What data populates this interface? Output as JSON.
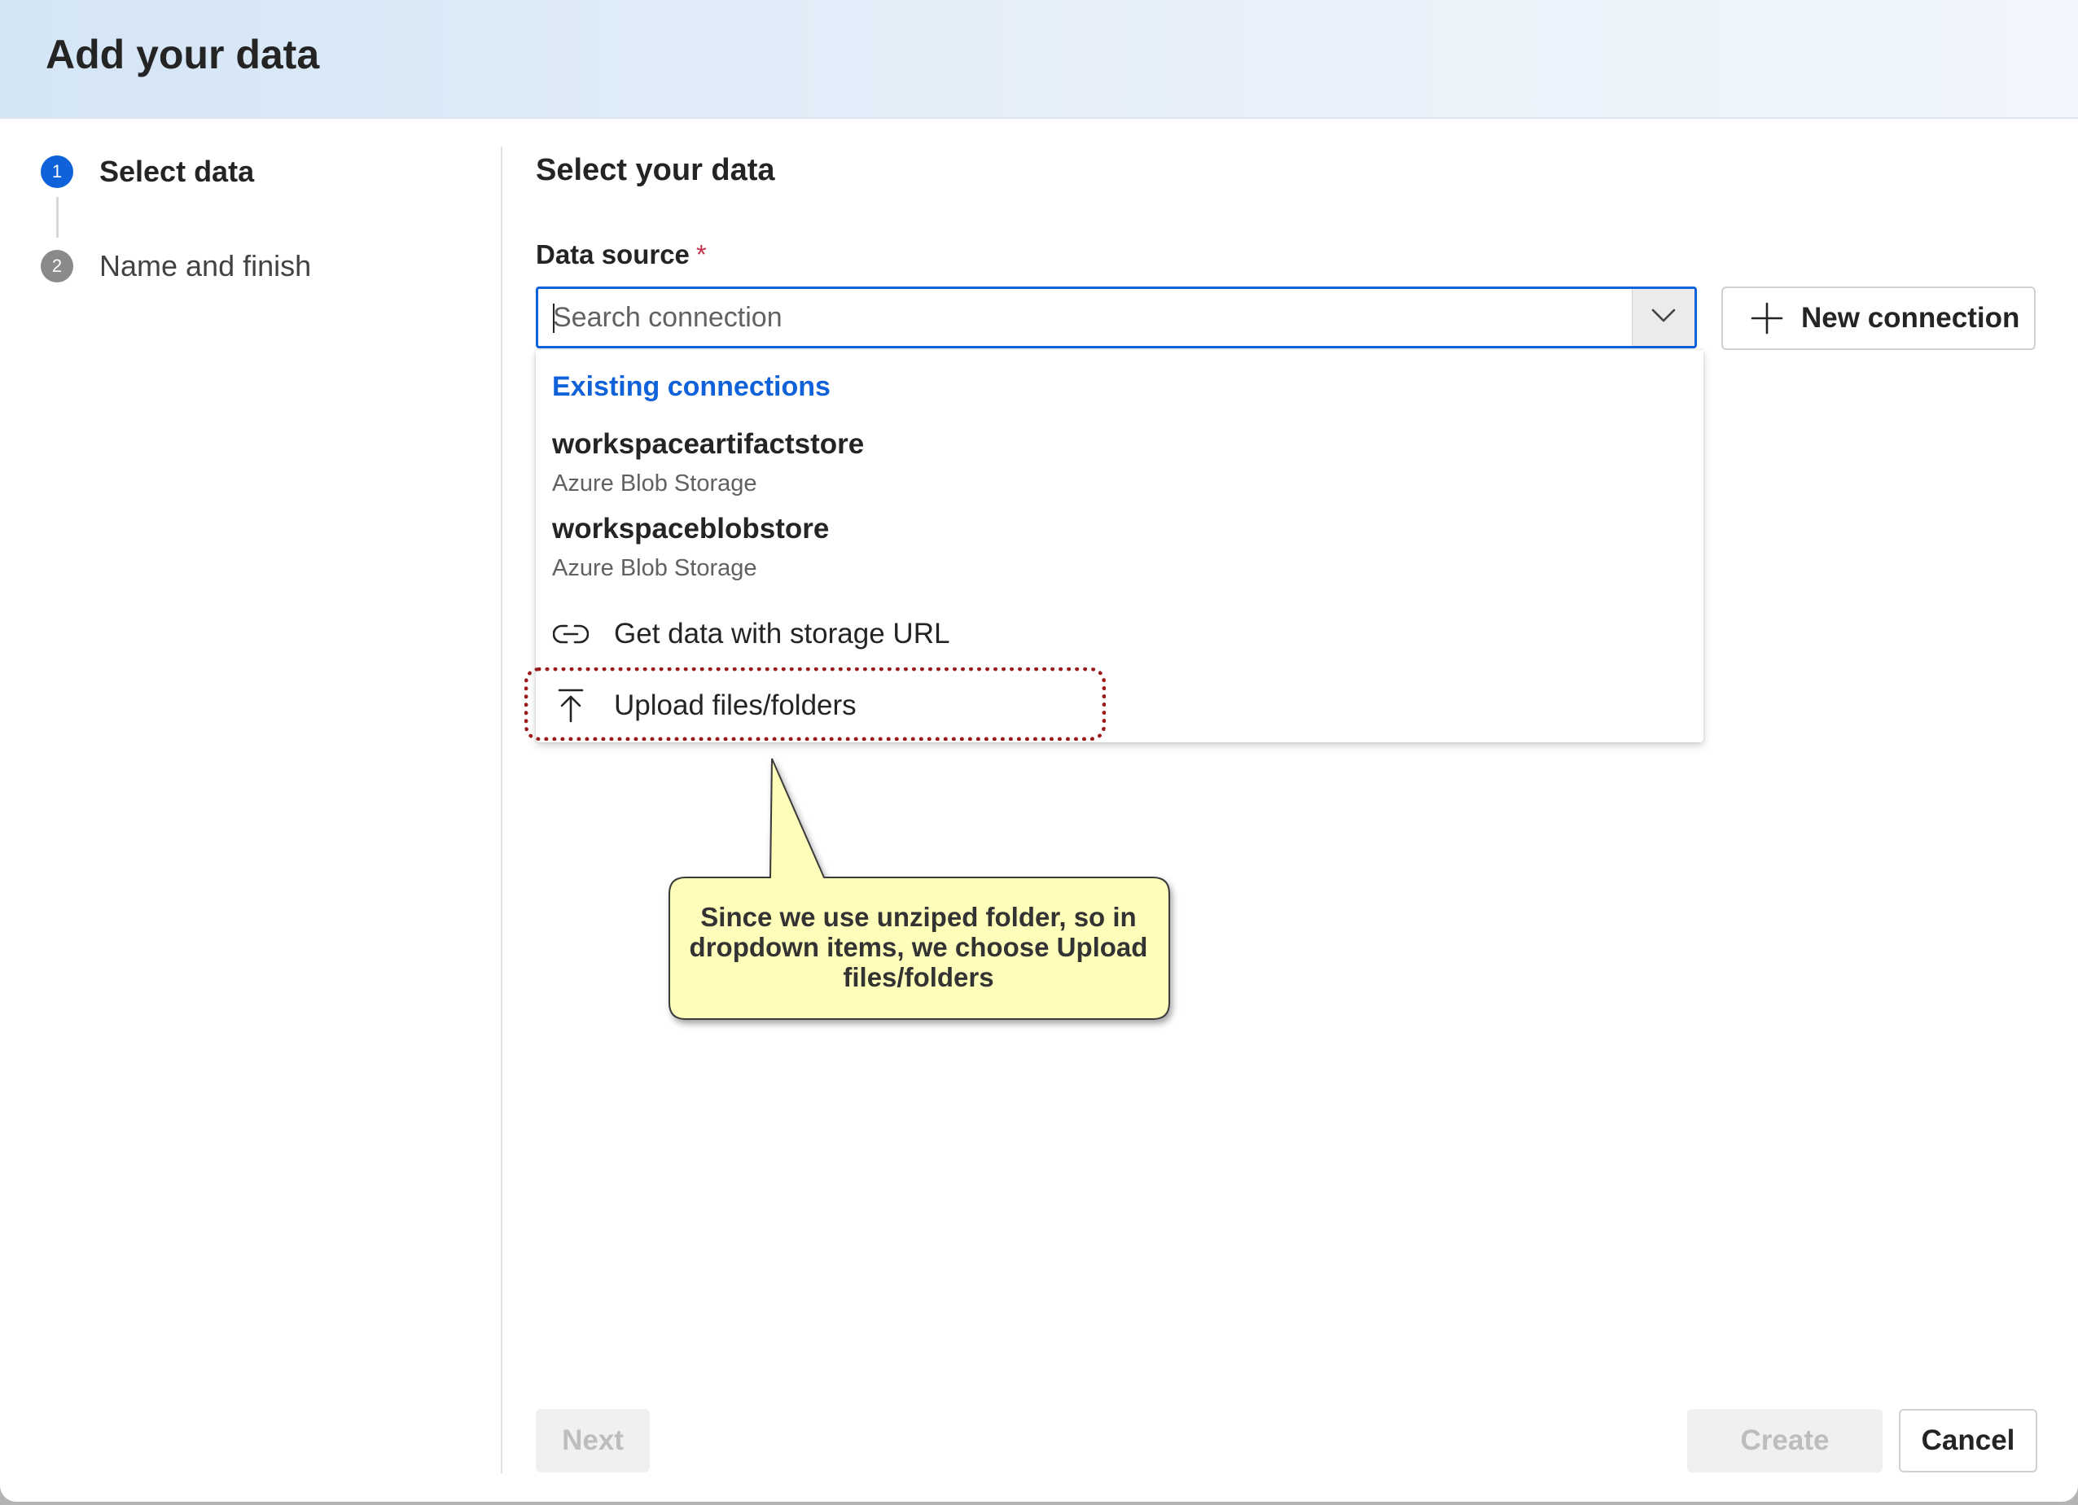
{
  "dialog": {
    "title": "Add your data"
  },
  "steps": [
    {
      "number": "1",
      "label": "Select data",
      "state": "active"
    },
    {
      "number": "2",
      "label": "Name and finish",
      "state": "pending"
    }
  ],
  "main": {
    "section_title": "Select your data",
    "data_source": {
      "label": "Data source",
      "required_mark": "*",
      "value": "",
      "placeholder": "Search connection"
    },
    "new_connection_label": "New connection"
  },
  "dropdown": {
    "group_label": "Existing connections",
    "items": [
      {
        "name": "workspaceartifactstore",
        "type": "Azure Blob Storage"
      },
      {
        "name": "workspaceblobstore",
        "type": "Azure Blob Storage"
      }
    ],
    "actions": [
      {
        "label": "Get data with storage URL",
        "icon": "link-icon"
      },
      {
        "label": "Upload files/folders",
        "icon": "upload-icon"
      }
    ]
  },
  "callout": {
    "lines": [
      "Since we use unziped folder, so in",
      "dropdown items, we choose Upload",
      "files/folders"
    ]
  },
  "footer": {
    "next_label": "Next",
    "create_label": "Create",
    "cancel_label": "Cancel"
  },
  "colors": {
    "accent": "#0f62d9",
    "highlight_border": "#9b1b1b",
    "callout_fill": "#fefdb9"
  }
}
